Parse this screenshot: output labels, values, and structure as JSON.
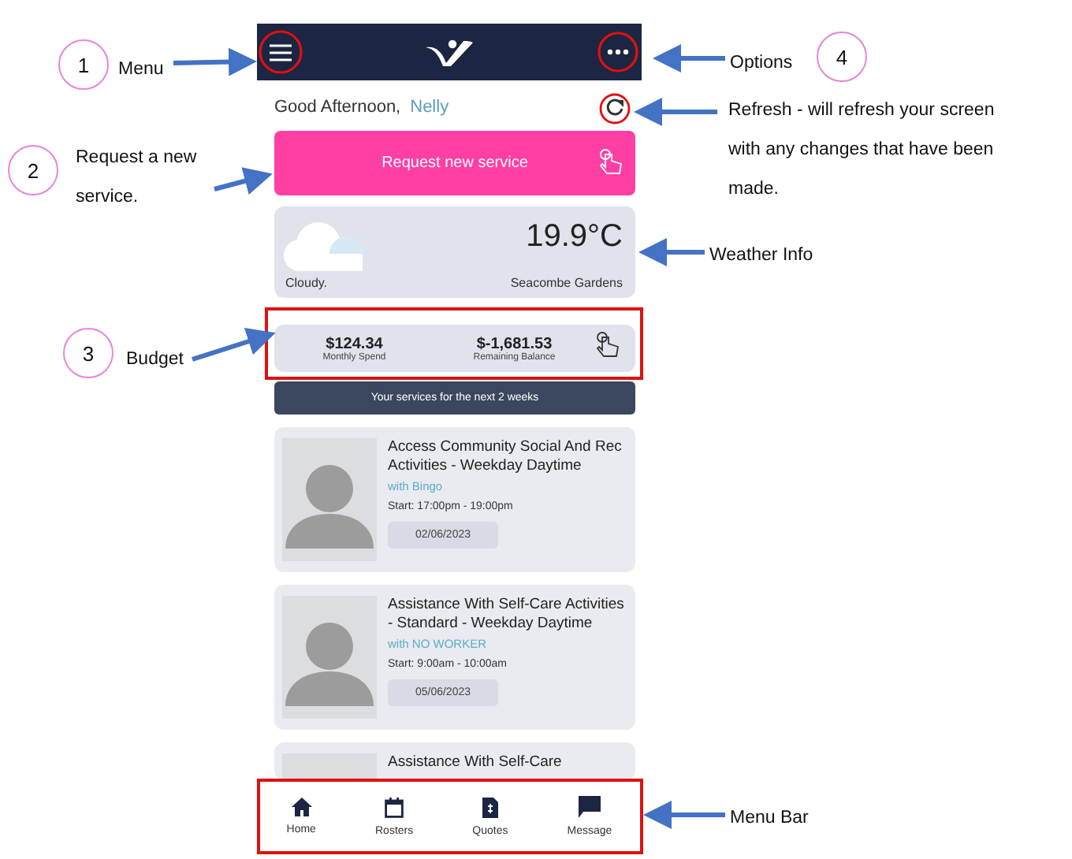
{
  "greeting": {
    "text": "Good Afternoon,",
    "name": "Nelly"
  },
  "request_button": "Request new service",
  "weather": {
    "temperature": "19.9°C",
    "condition": "Cloudy.",
    "location": "Seacombe Gardens"
  },
  "budget": [
    {
      "amount": "$124.34",
      "label": "Monthly Spend"
    },
    {
      "amount": "$-1,681.53",
      "label": "Remaining Balance"
    }
  ],
  "services_heading": "Your services for the next 2 weeks",
  "services": [
    {
      "title": "Access Community Social And Rec Activities - Weekday Daytime",
      "worker": "with Bingo",
      "start": "Start: 17:00pm - 19:00pm",
      "date": "02/06/2023"
    },
    {
      "title": "Assistance With Self-Care Activities - Standard - Weekday Daytime",
      "worker": "with NO WORKER",
      "start": "Start: 9:00am - 10:00am",
      "date": "05/06/2023"
    },
    {
      "title": "Assistance With Self-Care",
      "partial": true
    }
  ],
  "nav": [
    {
      "kind": "home",
      "label": "Home"
    },
    {
      "kind": "calendar",
      "label": "Rosters"
    },
    {
      "kind": "document",
      "label": "Quotes"
    },
    {
      "kind": "chat",
      "label": "Message"
    }
  ],
  "annotations": [
    {
      "number": "1",
      "label": "Menu"
    },
    {
      "number": "2",
      "label": "Request a new service."
    },
    {
      "number": "3",
      "label": "Budget"
    },
    {
      "number": "4",
      "label": "Options"
    },
    {
      "label": "Refresh - will refresh your screen with any changes that have been made."
    },
    {
      "label": "Weather Info"
    },
    {
      "label": "Menu Bar"
    }
  ]
}
